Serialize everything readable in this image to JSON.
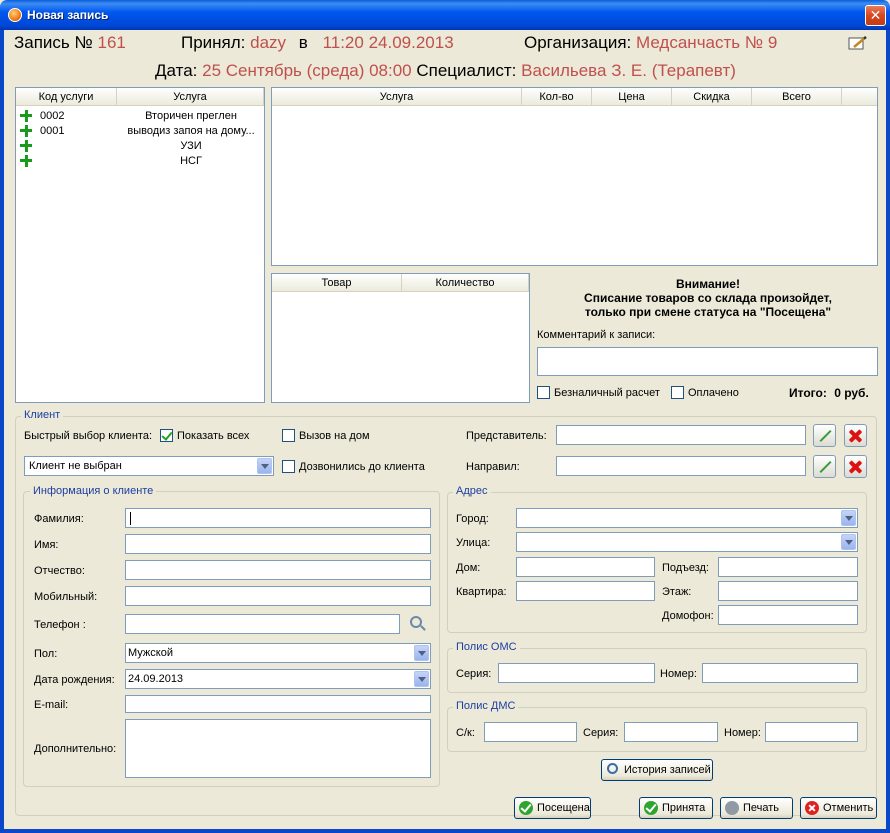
{
  "window": {
    "title": "Новая запись"
  },
  "header": {
    "record_label": "Запись №",
    "record_number": "161",
    "accepted_label": "Принял:",
    "accepted_by": "dazy",
    "at_label": "в",
    "accepted_time": "11:20 24.09.2013",
    "org_label": "Организация:",
    "org_value": "Медсанчасть № 9",
    "date_label": "Дата:",
    "date_value": "25 Сентябрь (среда) 08:00",
    "specialist_label": "Специалист:",
    "specialist_value": "Васильева З. Е. (Терапевт)"
  },
  "services_grid": {
    "columns": [
      "Код услуги",
      "Услуга"
    ],
    "rows": [
      {
        "code": "0002",
        "name": "Вторичен преглен"
      },
      {
        "code": "0001",
        "name": "выводиз запоя на дому..."
      },
      {
        "code": "",
        "name": "УЗИ"
      },
      {
        "code": "",
        "name": "НСГ"
      }
    ]
  },
  "selected_grid": {
    "columns": [
      "Услуга",
      "Кол-во",
      "Цена",
      "Скидка",
      "Всего"
    ]
  },
  "goods_grid": {
    "columns": [
      "Товар",
      "Количество"
    ]
  },
  "notice": {
    "line1": "Внимание!",
    "line2": "Списание товаров со склада произойдет,",
    "line3": "только при смене статуса на \"Посещена\""
  },
  "comment": {
    "label": "Комментарий к записи:",
    "value": ""
  },
  "payment": {
    "cashless_label": "Безналичный расчет",
    "paid_label": "Оплачено",
    "total_label": "Итого:",
    "total_value": "0 руб."
  },
  "client": {
    "group_title": "Клиент",
    "quick_select_label": "Быстрый выбор клиента:",
    "show_all_label": "Показать всех",
    "show_all_checked": true,
    "home_call_label": "Вызов на дом",
    "called_label": "Дозвонились до клиента",
    "client_select_value": "Клиент не выбран",
    "representative_label": "Представитель:",
    "referred_label": "Направил:"
  },
  "client_info": {
    "group_title": "Информация о клиенте",
    "surname_label": "Фамилия:",
    "name_label": "Имя:",
    "patronymic_label": "Отчество:",
    "mobile_label": "Мобильный:",
    "phone_label": "Телефон :",
    "gender_label": "Пол:",
    "gender_value": "Мужской",
    "birth_label": "Дата рождения:",
    "birth_value": "24.09.2013",
    "email_label": "E-mail:",
    "extra_label": "Дополнительно:"
  },
  "address": {
    "group_title": "Адрес",
    "city_label": "Город:",
    "street_label": "Улица:",
    "house_label": "Дом:",
    "entrance_label": "Подъезд:",
    "flat_label": "Квартира:",
    "floor_label": "Этаж:",
    "intercom_label": "Домофон:"
  },
  "oms": {
    "group_title": "Полис ОМС",
    "series_label": "Серия:",
    "number_label": "Номер:"
  },
  "dms": {
    "group_title": "Полис ДМС",
    "sk_label": "С/к:",
    "series_label": "Серия:",
    "number_label": "Номер:"
  },
  "buttons": {
    "history": "История записей",
    "visited": "Посещена",
    "accepted": "Принята",
    "print": "Печать",
    "cancel": "Отменить"
  },
  "colors": {
    "accent_red": "#c0504d",
    "group_title": "#1c3ea2",
    "title_bar": "#0058ee"
  }
}
